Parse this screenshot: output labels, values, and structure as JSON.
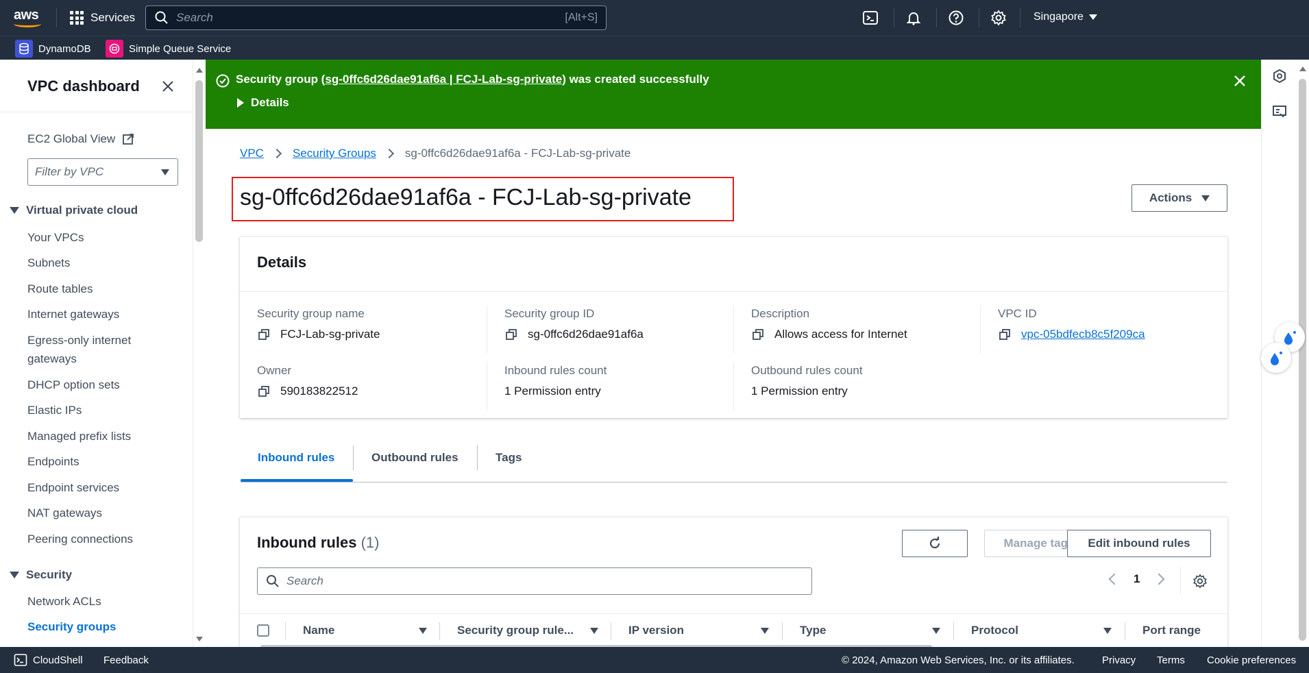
{
  "topnav": {
    "logo_text": "aws",
    "services_label": "Services",
    "search_placeholder": "Search",
    "search_shortcut": "[Alt+S]",
    "region": "Singapore"
  },
  "favorites": [
    {
      "label": "DynamoDB",
      "color": "#4053d6"
    },
    {
      "label": "Simple Queue Service",
      "color": "#e7157b"
    }
  ],
  "sidebar": {
    "title": "VPC dashboard",
    "ec2_global_view": "EC2 Global View",
    "filter_placeholder": "Filter by VPC",
    "sections": [
      {
        "label": "Virtual private cloud"
      },
      {
        "label": "Security"
      }
    ],
    "vpc_items": [
      "Your VPCs",
      "Subnets",
      "Route tables",
      "Internet gateways",
      "Egress-only internet gateways",
      "DHCP option sets",
      "Elastic IPs",
      "Managed prefix lists",
      "Endpoints",
      "Endpoint services",
      "NAT gateways",
      "Peering connections"
    ],
    "security_items": [
      "Network ACLs",
      "Security groups"
    ]
  },
  "flash": {
    "prefix": "Security group (",
    "link": "sg-0ffc6d26dae91af6a | FCJ-Lab-sg-private",
    "suffix": ") was created successfully",
    "details_label": "Details",
    "color": "#1d8102"
  },
  "breadcrumb": {
    "vpc": "VPC",
    "security_groups": "Security Groups",
    "current": "sg-0ffc6d26dae91af6a - FCJ-Lab-sg-private"
  },
  "page": {
    "title": "sg-0ffc6d26dae91af6a - FCJ-Lab-sg-private",
    "actions_label": "Actions"
  },
  "details": {
    "heading": "Details",
    "fields": {
      "sg_name_label": "Security group name",
      "sg_name_value": "FCJ-Lab-sg-private",
      "sg_id_label": "Security group ID",
      "sg_id_value": "sg-0ffc6d26dae91af6a",
      "description_label": "Description",
      "description_value": "Allows access for Internet",
      "vpc_id_label": "VPC ID",
      "vpc_id_value": "vpc-05bdfecb8c5f209ca",
      "owner_label": "Owner",
      "owner_value": "590183822512",
      "inbound_count_label": "Inbound rules count",
      "inbound_count_value": "1 Permission entry",
      "outbound_count_label": "Outbound rules count",
      "outbound_count_value": "1 Permission entry"
    }
  },
  "tabs": [
    "Inbound rules",
    "Outbound rules",
    "Tags"
  ],
  "rules": {
    "heading": "Inbound rules",
    "count": "(1)",
    "manage_tags_label": "Manage tags",
    "edit_label": "Edit inbound rules",
    "search_placeholder": "Search",
    "page_number": "1",
    "columns": [
      "Name",
      "Security group rule...",
      "IP version",
      "Type",
      "Protocol",
      "Port range"
    ]
  },
  "footer": {
    "cloudshell": "CloudShell",
    "feedback": "Feedback",
    "copyright": "© 2024, Amazon Web Services, Inc. or its affiliates.",
    "privacy": "Privacy",
    "terms": "Terms",
    "cookies": "Cookie preferences"
  }
}
